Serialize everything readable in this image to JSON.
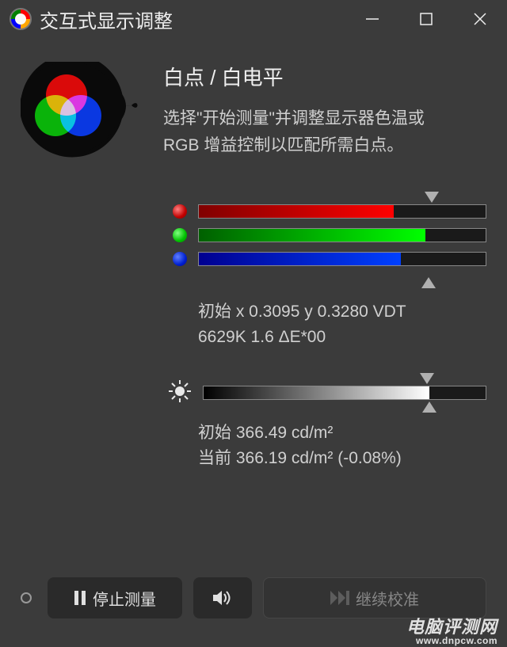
{
  "window": {
    "title": "交互式显示调整"
  },
  "panel": {
    "heading": "白点 / 白电平",
    "desc_line1": "选择\"开始测量\"并调整显示器色温或",
    "desc_line2": "RGB 增益控制以匹配所需白点。"
  },
  "rgb_sliders": {
    "target_marker_pct": 81,
    "current_marker_pct": 80,
    "channels": [
      {
        "name": "red",
        "fill_pct": 68,
        "color": "#d00000"
      },
      {
        "name": "green",
        "fill_pct": 79,
        "color": "#00c000"
      },
      {
        "name": "blue",
        "fill_pct": 70.5,
        "color": "#0020d0"
      }
    ]
  },
  "whitepoint_info": {
    "line1": "初始 x 0.3095 y 0.3280 VDT",
    "line2": "6629K 1.6 ΔE*00"
  },
  "brightness": {
    "target_marker_pct": 79,
    "current_marker_pct": 80,
    "line1": "初始 366.49 cd/m²",
    "line2": "当前 366.19 cd/m² (-0.08%)"
  },
  "footer": {
    "stop_label": "停止测量",
    "continue_label": "继续校准"
  },
  "watermark": {
    "line1": "电脑评测网",
    "line2": "www.dnpcw.com"
  }
}
